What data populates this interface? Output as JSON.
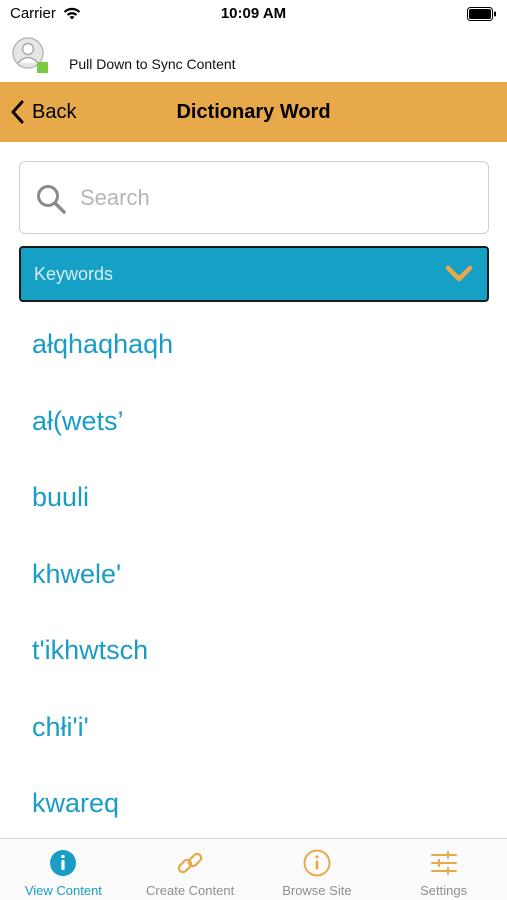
{
  "status_bar": {
    "carrier": "Carrier",
    "time": "10:09 AM"
  },
  "sync": {
    "text": "Pull Down to Sync Content"
  },
  "nav": {
    "back_label": "Back",
    "title": "Dictionary Word"
  },
  "search": {
    "placeholder": "Search",
    "value": ""
  },
  "filter": {
    "selected": "Keywords"
  },
  "words": [
    "ałqhaqhaqh",
    "ał(wets’",
    "buuli",
    "khwele'",
    "t'ikhwtsch",
    "chłi'i'",
    "kwareq"
  ],
  "tabs": [
    {
      "label": "View Content",
      "icon": "info-circle-filled-icon",
      "active": true
    },
    {
      "label": "Create Content",
      "icon": "link-icon",
      "active": false
    },
    {
      "label": "Browse Site",
      "icon": "info-circle-icon",
      "active": false
    },
    {
      "label": "Settings",
      "icon": "sliders-icon",
      "active": false
    }
  ],
  "colors": {
    "nav_bar": "#e8a94a",
    "accent": "#1a9dc5",
    "dropdown_bg": "#17a0c6",
    "chevron": "#e8a94a",
    "tab_inactive_icon": "#e8a94a",
    "sync_indicator": "#7ac943"
  }
}
